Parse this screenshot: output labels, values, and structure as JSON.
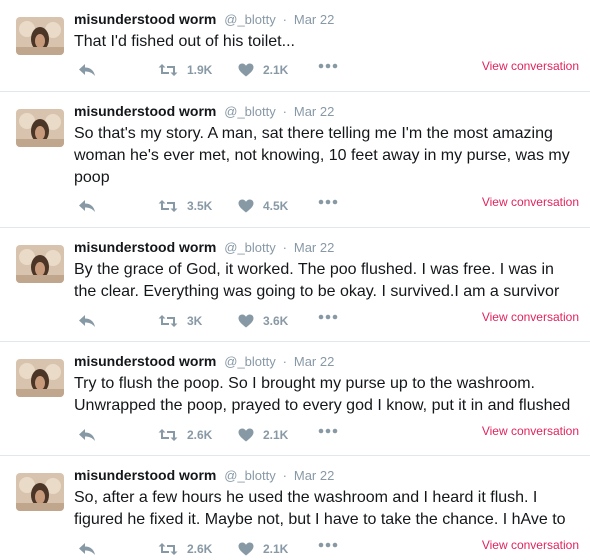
{
  "theme": {
    "accent": "#e0245e",
    "muted": "#8899a6",
    "text": "#14171a",
    "divider": "#e1e8ed"
  },
  "icons": {
    "reply": "reply-icon",
    "retweet": "retweet-icon",
    "like": "heart-icon",
    "more": "more-dots-icon"
  },
  "tweets": [
    {
      "name": "misunderstood worm",
      "handle": "@_blotty",
      "sep": "·",
      "date": "Mar 22",
      "text": "That I'd fished out of his toilet...",
      "retweets": "1.9K",
      "likes": "2.1K",
      "view": "View conversation"
    },
    {
      "name": "misunderstood worm",
      "handle": "@_blotty",
      "sep": "·",
      "date": "Mar 22",
      "text": "So that's my story. A man, sat there telling me I'm the most amazing woman he's ever met, not knowing, 10 feet away in my purse, was my poop",
      "retweets": "3.5K",
      "likes": "4.5K",
      "view": "View conversation"
    },
    {
      "name": "misunderstood worm",
      "handle": "@_blotty",
      "sep": "·",
      "date": "Mar 22",
      "text": "By the grace of God, it worked. The poo flushed. I was free. I was in the clear. Everything was going to be okay. I survived.I am a survivor",
      "retweets": "3K",
      "likes": "3.6K",
      "view": "View conversation"
    },
    {
      "name": "misunderstood worm",
      "handle": "@_blotty",
      "sep": "·",
      "date": "Mar 22",
      "text": "Try to flush the poop. So I brought my purse up to the washroom. Unwrapped the poop, prayed to every god I know, put it in and flushed",
      "retweets": "2.6K",
      "likes": "2.1K",
      "view": "View conversation"
    },
    {
      "name": "misunderstood worm",
      "handle": "@_blotty",
      "sep": "·",
      "date": "Mar 22",
      "text": "So, after a few hours he used the washroom and I heard it flush. I figured he fixed it. Maybe not, but I have to take the chance. I hAve to",
      "retweets": "2.6K",
      "likes": "2.1K",
      "view": "View conversation"
    }
  ]
}
